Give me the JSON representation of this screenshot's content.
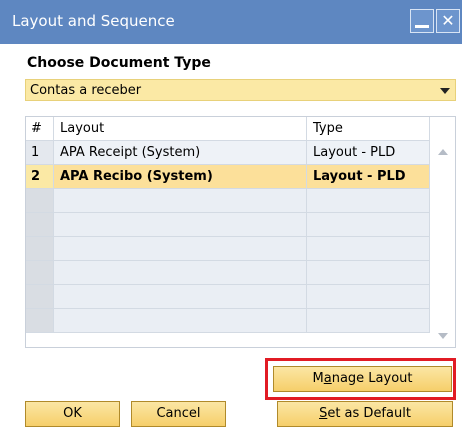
{
  "window": {
    "title": "Layout and Sequence",
    "controls": [
      "minimize-icon",
      "close-icon"
    ]
  },
  "doc_type": {
    "label": "Choose Document Type",
    "value": "Contas a receber"
  },
  "grid": {
    "headers": [
      "#",
      "Layout",
      "Type"
    ],
    "rows": [
      {
        "num": "1",
        "layout": "APA Receipt (System)",
        "type": "Layout - PLD"
      },
      {
        "num": "2",
        "layout": "APA Recibo (System)",
        "type": "Layout - PLD"
      }
    ]
  },
  "buttons": {
    "manage_layout": {
      "pre": "M",
      "accel": "a",
      "post": "nage Layout"
    },
    "ok": "OK",
    "cancel": "Cancel",
    "set_default": {
      "accel": "S",
      "post": "et as Default"
    }
  },
  "colors": {
    "titlebar": "#5e87c1",
    "field_yellow": "#fbe9a5",
    "selected_row": "#fce09a",
    "highlight_box": "#e11b24"
  }
}
